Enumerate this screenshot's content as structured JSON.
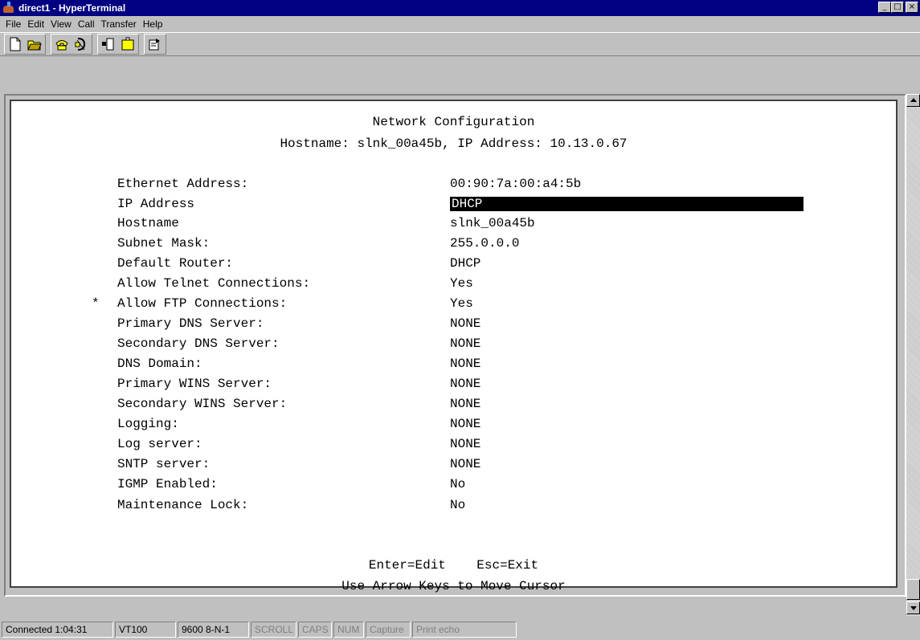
{
  "window": {
    "title": "direct1 - HyperTerminal",
    "minimize": "_",
    "maximize": "□",
    "close": "×"
  },
  "menu": [
    {
      "label": "File"
    },
    {
      "label": "Edit"
    },
    {
      "label": "View"
    },
    {
      "label": "Call"
    },
    {
      "label": "Transfer"
    },
    {
      "label": "Help"
    }
  ],
  "toolbar": {
    "buttons": [
      "new-icon",
      "open-icon",
      "connect-icon",
      "disconnect-icon",
      "send-icon",
      "receive-icon",
      "properties-icon"
    ]
  },
  "terminal": {
    "title": "Network Configuration",
    "subtitle": "Hostname: slnk_00a45b, IP Address: 10.13.0.67",
    "marker": "*",
    "rows": [
      {
        "label": "Ethernet Address:",
        "value": "00:90:7a:00:a4:5b"
      },
      {
        "label": "IP Address",
        "value": "DHCP"
      },
      {
        "label": "Hostname",
        "value": "slnk_00a45b"
      },
      {
        "label": "Subnet Mask:",
        "value": "255.0.0.0"
      },
      {
        "label": "Default Router:",
        "value": "DHCP"
      },
      {
        "label": "Allow Telnet Connections:",
        "value": "Yes"
      },
      {
        "label": "Allow FTP Connections:",
        "value": "Yes"
      },
      {
        "label": "Primary DNS Server:",
        "value": "NONE"
      },
      {
        "label": "Secondary DNS Server:",
        "value": "NONE"
      },
      {
        "label": "DNS Domain:",
        "value": "NONE"
      },
      {
        "label": "Primary WINS Server:",
        "value": "NONE"
      },
      {
        "label": "Secondary WINS Server:",
        "value": "NONE"
      },
      {
        "label": "Logging:",
        "value": "NONE"
      },
      {
        "label": "Log server:",
        "value": "NONE"
      },
      {
        "label": "SNTP server:",
        "value": "NONE"
      },
      {
        "label": "IGMP Enabled:",
        "value": "No"
      },
      {
        "label": "Maintenance Lock:",
        "value": "No"
      }
    ],
    "footer1": "Enter=Edit    Esc=Exit",
    "footer2": "Use Arrow Keys to Move Cursor"
  },
  "status": {
    "connected": "Connected 1:04:31",
    "emulation": "VT100",
    "port": "9600 8-N-1",
    "scroll": "SCROLL",
    "caps": "CAPS",
    "num": "NUM",
    "capture": "Capture",
    "print_echo": "Print echo"
  }
}
